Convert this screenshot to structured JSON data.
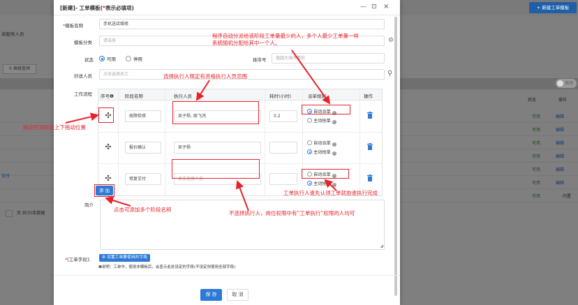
{
  "background": {
    "new_button": "+ 新建工单模板",
    "left_label": "单服务人员",
    "adv_search": "高级查询",
    "toggle": "关闭",
    "col_status": "状态",
    "col_ops": "操作",
    "row_status": "可用",
    "row_edit": "编辑",
    "row_side_text": "交付",
    "row_inner": "内置",
    "pager_text": "页 共(5)条数据"
  },
  "modal": {
    "title_prefix": "[新建]- 工单模板(",
    "title_star": "*",
    "title_suffix": "表示必填项)",
    "minimize": "—",
    "maximize": "⊡",
    "close": "×"
  },
  "form": {
    "name_label": "模板名称",
    "name_value": "手机送店维修",
    "category_label": "模板分类",
    "category_placeholder": "请选择",
    "status_label": "状态",
    "status_options": [
      "可用",
      "停用"
    ],
    "sort_label": "排序号",
    "sort_placeholder": "值越大排序靠前",
    "cc_label": "抄送人员",
    "cc_placeholder": "点击选择员工",
    "flow_label": "工作流程",
    "intro_label": "简介",
    "fields_label": "[工单字段]:",
    "fields_button": "设置工单要使用的字段",
    "fields_note": "❶说明：工单中，使用本模板后，会显示此处设定的字段(不设定则使用全部字段)",
    "save": "保 存",
    "cancel": "取 消"
  },
  "table": {
    "headers": [
      "序号❶",
      "阶段名称",
      "执行人员",
      "耗时(小时)",
      "派单规则",
      "操作"
    ],
    "auto_dispatch": "自动派单",
    "manual_grab": "主动抢单",
    "rows": [
      {
        "stage": "故障检修",
        "executors": "吴子杨, 周飞鸿",
        "hours": "0.2",
        "rule": "auto"
      },
      {
        "stage": "报价确认",
        "executors": "吴子杨",
        "hours": "",
        "rule": "manual"
      },
      {
        "stage": "修复交付",
        "executors": "点击选择人员",
        "hours": "",
        "rule": "manual"
      }
    ],
    "add_button": "添 加"
  },
  "annotations": {
    "auto_assign": "程序自动分派给该阶段工单量最少的人，多个人最少工单量一样\n系统随机分配给其中一个人。",
    "executor_scope": "选择执行人限定有资格执行人员范围",
    "drag": "拖动可对阶段上下拖动位置",
    "grab": "工单执行人谁先认领工单就由谁执行完成",
    "add_stages": "点击可添加多个阶段名称",
    "no_executor": "不选择执行人，岗位权限中有“工单执行”权限的人均可"
  },
  "colors": {
    "accent": "#2d7ad6",
    "annotation": "#e8222a",
    "required": "#e02020"
  }
}
